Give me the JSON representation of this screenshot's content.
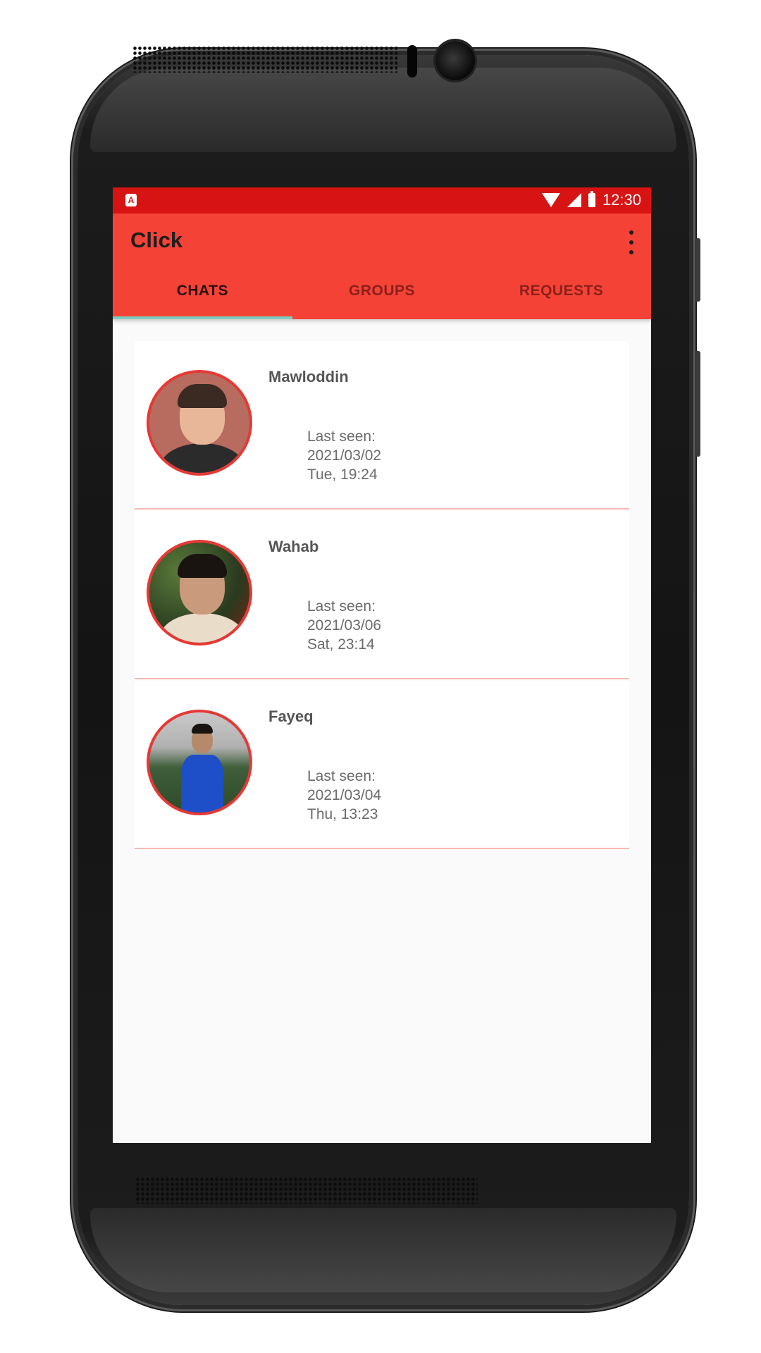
{
  "device": {
    "brand": "htc"
  },
  "status_bar": {
    "time": "12:30",
    "app_notification_icon": "app-notification-icon",
    "icons": [
      "wifi-icon",
      "cellular-signal-icon",
      "battery-icon"
    ]
  },
  "toolbar": {
    "title": "Click",
    "menu_icon": "more-vert-icon"
  },
  "tabs": [
    {
      "label": "CHATS",
      "active": true
    },
    {
      "label": "GROUPS",
      "active": false
    },
    {
      "label": "REQUESTS",
      "active": false
    }
  ],
  "chats": [
    {
      "name": "Mawloddin",
      "last_seen_label": "Last seen:",
      "date": "2021/03/02",
      "day_time": "Tue, 19:24"
    },
    {
      "name": "Wahab",
      "last_seen_label": "Last seen:",
      "date": "2021/03/06",
      "day_time": "Sat, 23:14"
    },
    {
      "name": "Fayeq",
      "last_seen_label": "Last seen:",
      "date": "2021/03/04",
      "day_time": "Thu, 13:23"
    }
  ],
  "colors": {
    "primary": "#f44336",
    "primary_dark": "#d81313",
    "tab_indicator": "#7fcbc0",
    "avatar_border": "#e53935",
    "divider": "#f7b9b3"
  }
}
